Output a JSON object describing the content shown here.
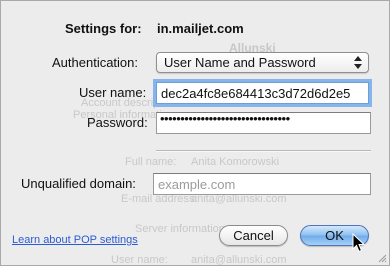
{
  "header": {
    "settings_label": "Settings for:",
    "account_name": "in.mailjet.com"
  },
  "form": {
    "authentication": {
      "label": "Authentication:",
      "value": "User Name and Password"
    },
    "user_name": {
      "label": "User name:",
      "value": "dec2a4fc8e684413c3d72d6d2e5"
    },
    "password": {
      "label": "Password:",
      "masked_value": "••••••••••••••••••••••••••••••••"
    },
    "unqualified_domain": {
      "label": "Unqualified domain:",
      "placeholder": "example.com",
      "value": ""
    }
  },
  "footer": {
    "help_link": "Learn about POP settings",
    "cancel_label": "Cancel",
    "ok_label": "OK"
  },
  "background_window": {
    "name": "Allunski",
    "rows": [
      "Account description",
      "Personal information",
      "Full name:",
      "Anita Komorowski",
      "E-mail address:",
      "anita@allunski.com",
      "Server information",
      "User name:",
      "anita@allunski.com"
    ]
  },
  "colors": {
    "link": "#2b5bd6",
    "focus_ring": "#86b4ec",
    "default_button": "#6fabe9"
  }
}
